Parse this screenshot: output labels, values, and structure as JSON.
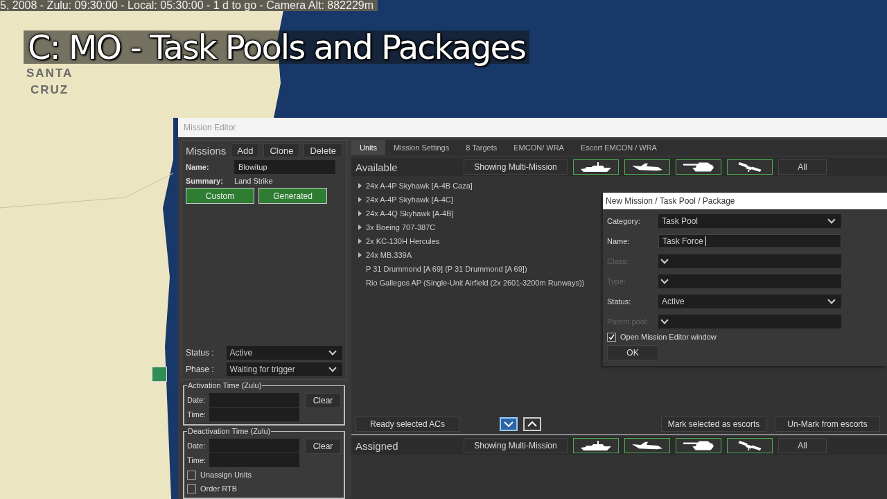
{
  "status_bar": {
    "text": "5, 2008 - Zulu: 09:30:00 - Local: 05:30:00 - 1 d to go -  Camera Alt: 882229m"
  },
  "overlay_title": "C: MO - Task Pools and Packages",
  "map_labels": [
    "SANTA",
    "CRUZ"
  ],
  "mission_editor": {
    "title": "Mission Editor",
    "missions": {
      "heading": "Missions",
      "buttons": [
        "Add",
        "Clone",
        "Delete"
      ],
      "name_label": "Name:",
      "name_value": "Blowitup",
      "summary_label": "Summary:",
      "summary_value": "Land Strike",
      "toggles": [
        {
          "label": "Custom",
          "on": true
        },
        {
          "label": "Generated",
          "on": true
        }
      ],
      "status": {
        "label": "Status :",
        "value": "Active"
      },
      "phase": {
        "label": "Phase :",
        "value": "Waiting for trigger"
      }
    },
    "activation": {
      "title": "Activation Time (Zulu)",
      "date_label": "Date:",
      "time_label": "Time:",
      "clear": "Clear"
    },
    "deactivation": {
      "title": "Deactivation Time (Zulu)",
      "date_label": "Date:",
      "time_label": "Time:",
      "clear": "Clear",
      "checkboxes": [
        {
          "label": "Unassign Units",
          "checked": false
        },
        {
          "label": "Order RTB",
          "checked": false
        }
      ]
    },
    "tabs": [
      {
        "label": "Units",
        "selected": true
      },
      {
        "label": "Mission Settings",
        "selected": false
      },
      {
        "label": "8 Targets",
        "selected": false
      },
      {
        "label": "EMCON/ WRA",
        "selected": false
      },
      {
        "label": "Escort EMCON / WRA",
        "selected": false
      }
    ],
    "available": {
      "title": "Available",
      "filter": "Showing Multi-Mission",
      "type_filters": [
        {
          "kind": "ship",
          "on": true
        },
        {
          "kind": "aircraft",
          "on": true
        },
        {
          "kind": "tank",
          "on": true
        },
        {
          "kind": "satellite",
          "on": true
        }
      ],
      "all": "All"
    },
    "units": [
      {
        "label": "24x A-4P Skyhawk [A-4B Caza]",
        "expandable": true
      },
      {
        "label": "24x A-4P Skyhawk [A-4C]",
        "expandable": true
      },
      {
        "label": "24x A-4Q Skyhawk [A-4B]",
        "expandable": true
      },
      {
        "label": "3x Boeing 707-387C",
        "expandable": true
      },
      {
        "label": "2x KC-130H Hercules",
        "expandable": true
      },
      {
        "label": "24x MB.339A",
        "expandable": true
      },
      {
        "label": "P 31 Drummond [A 69] (P 31 Drummond [A 69])",
        "expandable": false
      },
      {
        "label": "Rio Gallegos AP (Single-Unit Airfield (2x 2601-3200m Runways))",
        "expandable": false
      }
    ],
    "actions": {
      "ready": "Ready selected ACs",
      "arrows": [
        {
          "kind": "down",
          "selected": true
        },
        {
          "kind": "up",
          "selected": false
        }
      ],
      "mark": "Mark selected as escorts",
      "unmark": "Un-Mark from escorts"
    },
    "assigned": {
      "title": "Assigned",
      "filter": "Showing Multi-Mission",
      "type_filters": [
        {
          "kind": "ship",
          "on": true
        },
        {
          "kind": "aircraft",
          "on": true
        },
        {
          "kind": "tank",
          "on": true
        },
        {
          "kind": "satellite",
          "on": true
        }
      ],
      "all": "All"
    }
  },
  "dialog": {
    "title": "New Mission / Task Pool / Package",
    "fields": [
      {
        "label": "Category:",
        "kind": "select",
        "value": "Task Pool",
        "disabled": false
      },
      {
        "label": "Name:",
        "kind": "text",
        "value": "Task Force ",
        "disabled": false
      },
      {
        "label": "Class:",
        "kind": "select",
        "disabled": true
      },
      {
        "label": "Type:",
        "kind": "select",
        "disabled": true
      },
      {
        "label": "Status:",
        "kind": "select",
        "value": "Active",
        "disabled": false
      },
      {
        "label": "Parent pool:",
        "kind": "select",
        "disabled": true
      }
    ],
    "checkbox": {
      "label": "Open Mission Editor window",
      "checked": true
    },
    "ok": "OK"
  }
}
